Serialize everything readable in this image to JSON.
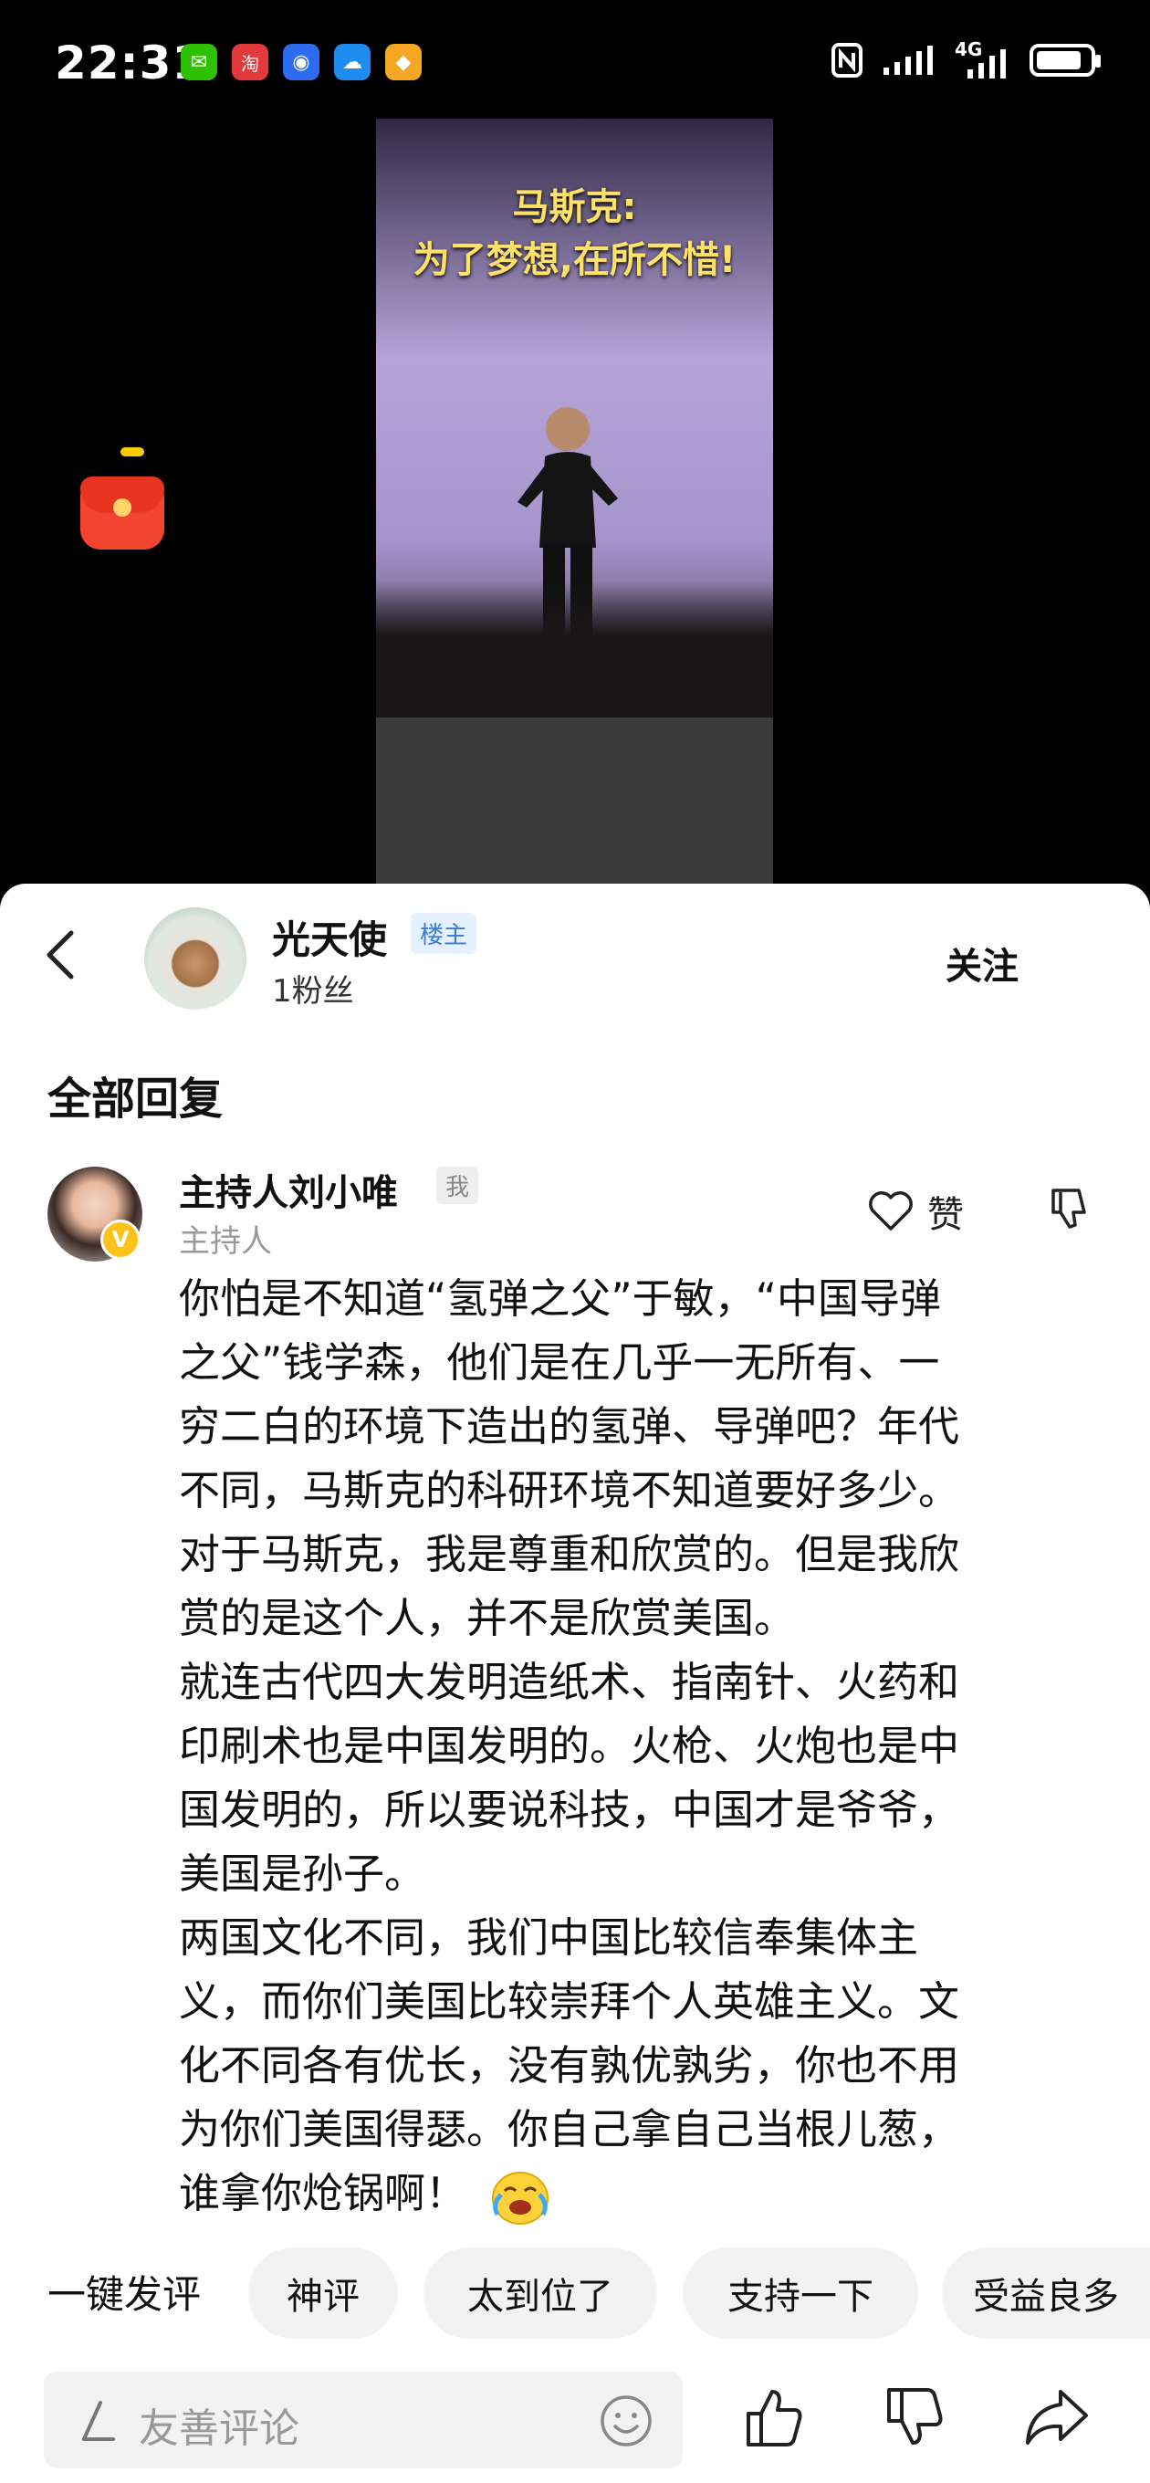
{
  "status_bar": {
    "time": "22:31",
    "network": "4G",
    "battery_level": 0.85,
    "app_icons": [
      {
        "name": "wechat-icon",
        "color": "#2dc100",
        "glyph": "✉"
      },
      {
        "name": "taobao-icon",
        "color": "#e4393c",
        "glyph": "淘"
      },
      {
        "name": "assistant-icon",
        "color": "#2d6cf0",
        "glyph": "◉"
      },
      {
        "name": "weather-icon",
        "color": "#1e8cf0",
        "glyph": "☁"
      },
      {
        "name": "coupon-icon",
        "color": "#f5a623",
        "glyph": "◆"
      }
    ]
  },
  "video": {
    "title_line1": "马斯克:",
    "title_line2": "为了梦想,在所不惜!"
  },
  "post": {
    "author": "光天使",
    "owner_badge": "楼主",
    "fans": "1粉丝",
    "follow_label": "关注"
  },
  "section_title": "全部回复",
  "comment": {
    "author": "主持人刘小唯",
    "me_badge": "我",
    "role": "主持人",
    "like_label": "赞",
    "text": "你怕是不知道“氢弹之父”于敏，“中国导弹\n之父”钱学森，他们是在几乎一无所有、一\n穷二白的环境下造出的氢弹、导弹吧？年代\n不同，马斯克的科研环境不知道要好多少。\n对于马斯克，我是尊重和欣赏的。但是我欣\n赏的是这个人，并不是欣赏美国。\n就连古代四大发明造纸术、指南针、火药和\n印刷术也是中国发明的。火枪、火炮也是中\n国发明的，所以要说科技，中国才是爷爷，\n美国是孙子。\n两国文化不同，我们中国比较信奉集体主\n义，而你们美国比较崇拜个人英雄主义。文\n化不同各有优长，没有孰优孰劣，你也不用\n为你们美国得瑟。你自己拿自己当根儿葱，\n谁拿你炝锅啊！"
  },
  "quick_replies": {
    "label": "一键发评",
    "chips": [
      "神评",
      "太到位了",
      "支持一下",
      "受益良多"
    ]
  },
  "input": {
    "placeholder": "友善评论"
  }
}
